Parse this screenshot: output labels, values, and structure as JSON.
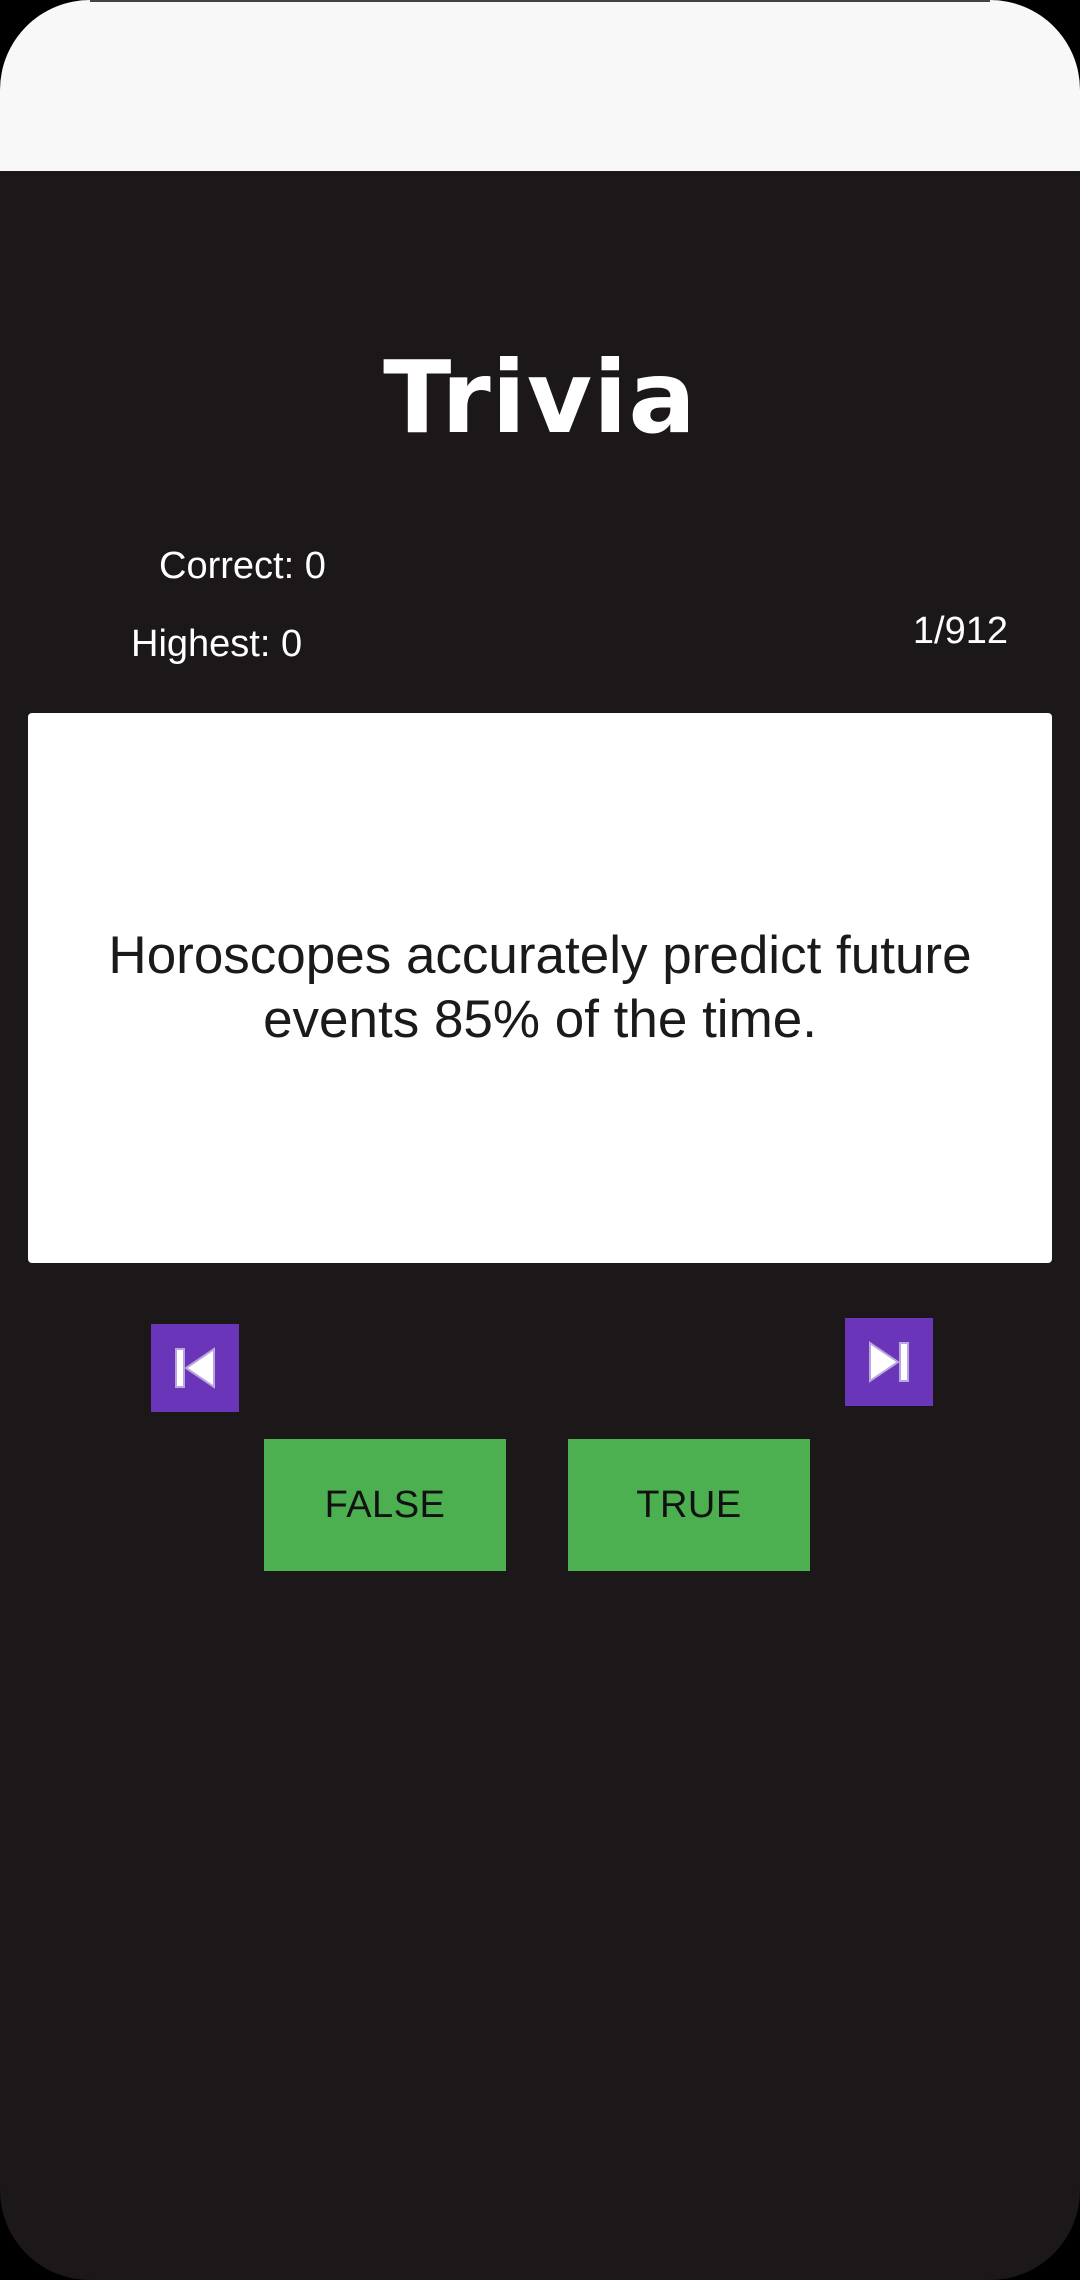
{
  "app": {
    "title": "Trivia"
  },
  "stats": {
    "correct": "Correct: 0",
    "highest": "Highest: 0",
    "counter": "1/912"
  },
  "question": {
    "text": "Horoscopes accurately predict future events 85% of the time."
  },
  "navigation": {
    "prev_icon": "skip-previous-icon",
    "next_icon": "skip-next-icon"
  },
  "answers": {
    "false_label": "FALSE",
    "true_label": "TRUE"
  },
  "colors": {
    "background": "#1c1819",
    "status_bar": "#f8f8f8",
    "nav_button": "#6a35b8",
    "answer_button": "#4caf50",
    "card": "#ffffff"
  }
}
